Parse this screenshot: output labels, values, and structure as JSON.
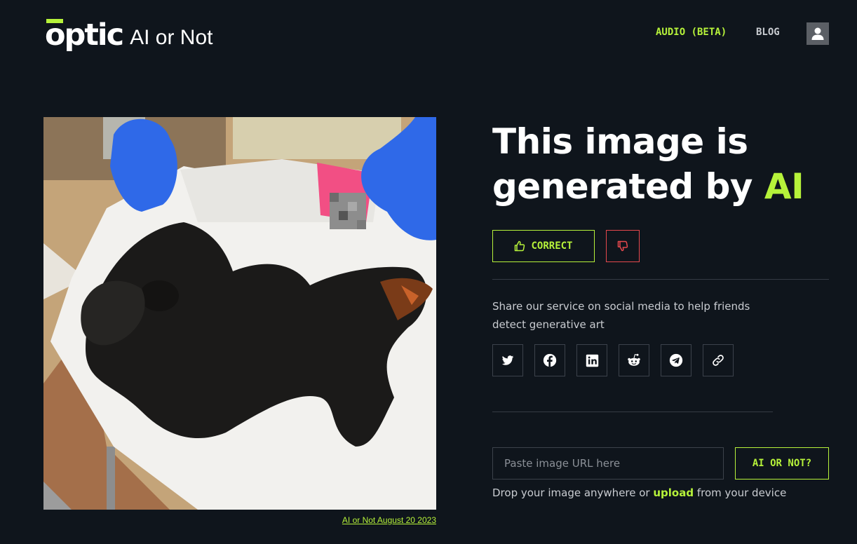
{
  "header": {
    "logo_word": "optic",
    "logo_sub": "AI or Not",
    "nav": [
      {
        "label": "AUDIO (BETA)"
      },
      {
        "label": "BLOG"
      }
    ],
    "user_icon": "user-icon"
  },
  "image": {
    "caption": "AI or Not August 20 2023"
  },
  "result": {
    "headline_prefix": "This image is generated by ",
    "headline_highlight": "AI",
    "correct_label": "CORRECT",
    "correct_icon": "thumbs-up-icon",
    "wrong_icon": "thumbs-down-icon",
    "share_text": "Share our service on social media to help friends detect generative art",
    "socials": [
      {
        "icon": "twitter-icon"
      },
      {
        "icon": "facebook-icon"
      },
      {
        "icon": "linkedin-icon"
      },
      {
        "icon": "reddit-icon"
      },
      {
        "icon": "telegram-icon"
      },
      {
        "icon": "link-icon"
      }
    ]
  },
  "form": {
    "url_placeholder": "Paste image URL here",
    "url_value": "",
    "submit_label": "AI OR NOT?",
    "drop_prefix": "Drop your image anywhere or ",
    "drop_link": "upload",
    "drop_suffix": " from your device"
  },
  "colors": {
    "background": "#0f151c",
    "accent": "#b6f23a",
    "danger": "#e5484d",
    "text_muted": "#c9ccd1"
  }
}
